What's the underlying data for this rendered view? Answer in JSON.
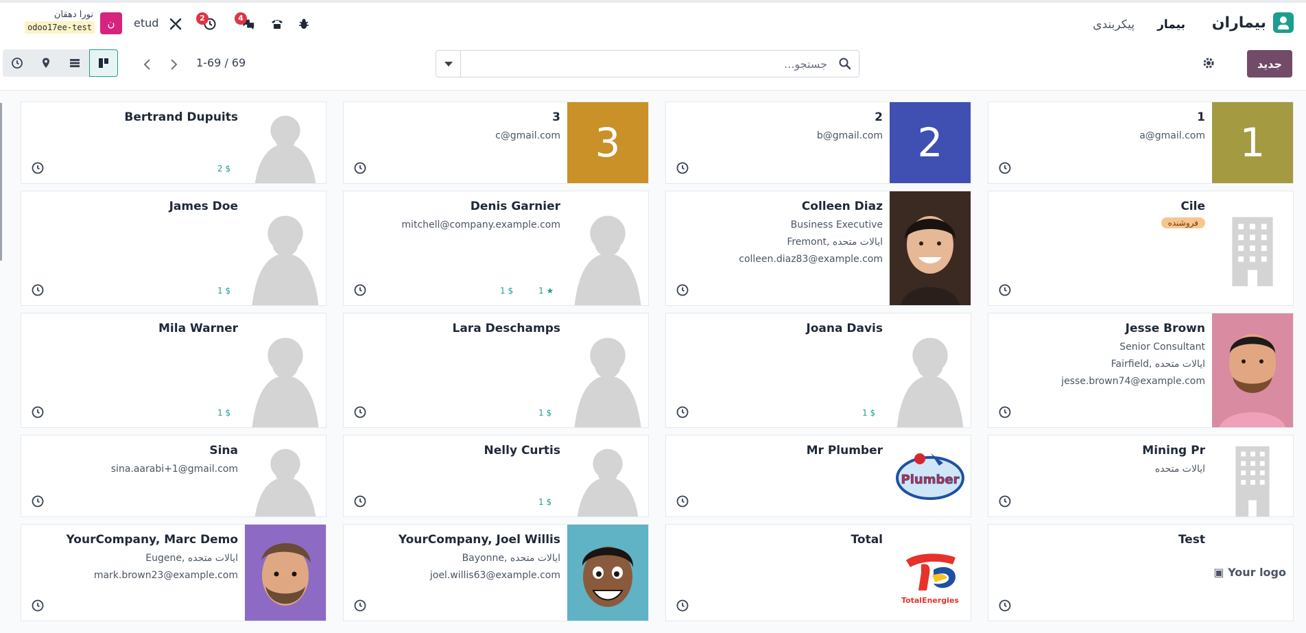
{
  "navbar": {
    "app_name": "بیماران",
    "menu_patients": "بیمار",
    "menu_config": "پیکربندی",
    "user_name": "نورا دهقان",
    "db_name": "odoo17ee-test",
    "avatar_letter": "ن",
    "company": "etud",
    "activity_count": "2",
    "messages_count": "4"
  },
  "control": {
    "new_label": "جدید",
    "search_placeholder": "جستجو...",
    "pager": "1-69 / 69"
  },
  "cards": [
    {
      "title": "1",
      "lines": [
        "a@gmail.com"
      ],
      "big_num": "1",
      "big_color": "#a39a42",
      "stats": []
    },
    {
      "title": "2",
      "lines": [
        "b@gmail.com"
      ],
      "big_num": "2",
      "big_color": "#3f4fb2",
      "stats": []
    },
    {
      "title": "3",
      "lines": [
        "c@gmail.com"
      ],
      "big_num": "3",
      "big_color": "#c99127",
      "stats": []
    },
    {
      "title": "Bertrand Dupuits",
      "lines": [],
      "stats": [
        "2 $"
      ]
    },
    {
      "title": "Cile",
      "tag": "فروشنده",
      "lines": [],
      "stats": []
    },
    {
      "title": "Colleen Diaz",
      "lines": [
        "Business Executive",
        "Fremont, ایالات متحده",
        "colleen.diaz83@example.com"
      ],
      "stats": []
    },
    {
      "title": "Denis Garnier",
      "lines": [
        "mitchell@company.example.com"
      ],
      "stats": [
        "1 $",
        "1 ★"
      ]
    },
    {
      "title": "James Doe",
      "lines": [],
      "stats": [
        "1 $"
      ]
    },
    {
      "title": "Jesse Brown",
      "lines": [
        "Senior Consultant",
        "Fairfield, ایالات متحده",
        "jesse.brown74@example.com"
      ],
      "stats": []
    },
    {
      "title": "Joana Davis",
      "lines": [],
      "stats": [
        "1 $"
      ]
    },
    {
      "title": "Lara Deschamps",
      "lines": [],
      "stats": [
        "1 $"
      ]
    },
    {
      "title": "Mila Warner",
      "lines": [],
      "stats": [
        "1 $"
      ]
    },
    {
      "title": "Mining Pr",
      "lines": [
        "ایالات متحده"
      ],
      "stats": []
    },
    {
      "title": "Mr Plumber",
      "lines": [],
      "logo": "Plumber",
      "stats": []
    },
    {
      "title": "Nelly Curtis",
      "lines": [],
      "stats": [
        "1 $"
      ]
    },
    {
      "title": "Sina",
      "lines": [
        "sina.aarabi+1@gmail.com"
      ],
      "stats": []
    },
    {
      "title": "Test",
      "lines": [],
      "your_logo": "Your logo",
      "stats": []
    },
    {
      "title": "Total",
      "lines": [],
      "logo": "TotalEnergies",
      "stats": []
    },
    {
      "title": "YourCompany, Joel Willis",
      "lines": [
        "Bayonne, ایالات متحده",
        "joel.willis63@example.com"
      ],
      "stats": []
    },
    {
      "title": "YourCompany, Marc Demo",
      "lines": [
        "Eugene, ایالات متحده",
        "mark.brown23@example.com"
      ],
      "stats": []
    }
  ]
}
